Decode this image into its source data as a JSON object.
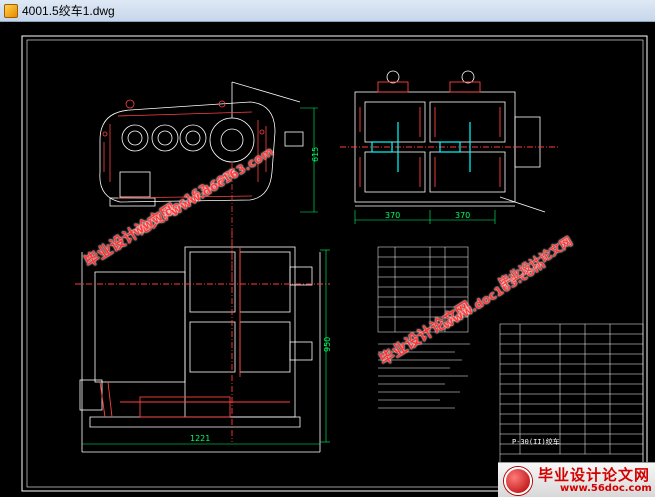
{
  "window": {
    "title": "4001.5绞车1.dwg",
    "icon": "dwg-file-icon"
  },
  "drawing": {
    "dims": {
      "left_width": "370",
      "right_width": "370",
      "height_top": "615",
      "height_main": "950",
      "base_width": "1221"
    },
    "title_block_name": "P-30(II)绞车",
    "colors": {
      "frame": "#ffffff",
      "outline": "#ffffff",
      "hatch": "#ff4040",
      "dim": "#00ff66",
      "center": "#ff3b3b",
      "accent": "#00ffff"
    }
  },
  "watermarks": [
    {
      "cn": "毕业设计论文网",
      "url": "www.doc163.com"
    },
    {
      "cn": "毕业设计论文网",
      "url": "www.doc163.com"
    },
    {
      "cn": "毕业设计论文网",
      "url": "www.doc163.com"
    }
  ],
  "footer": {
    "logo_text": "毕业设计论文网",
    "logo_url": "www.56doc.com"
  }
}
